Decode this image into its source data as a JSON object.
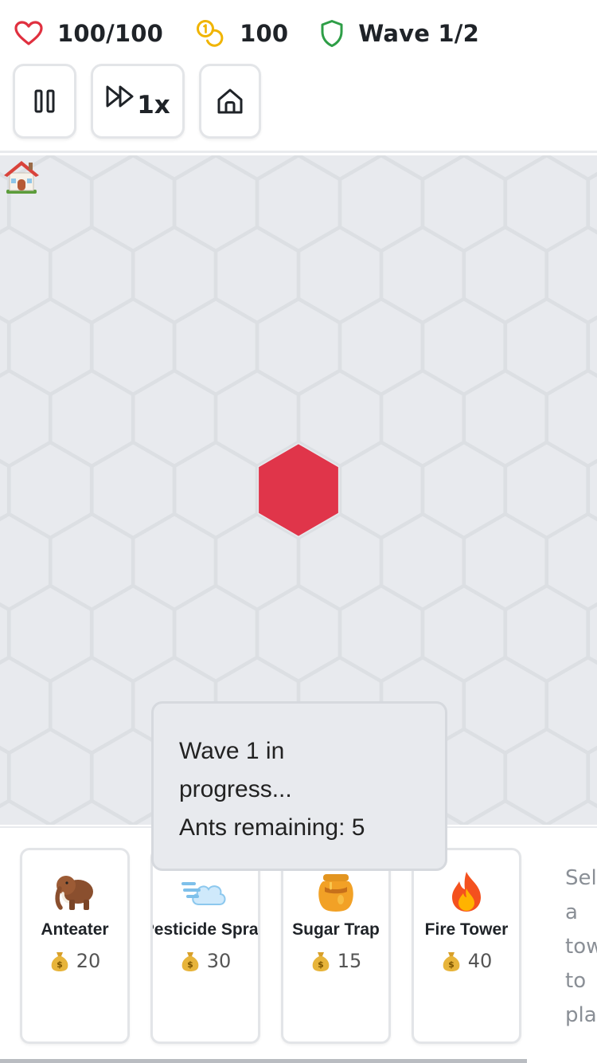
{
  "hud": {
    "lives": "100/100",
    "gold": "100",
    "wave": "Wave 1/2",
    "speed_label": "1x",
    "icons": {
      "lives": "heart-icon",
      "gold": "coins-icon",
      "wave": "shield-icon",
      "pause": "pause-icon",
      "speed": "fast-forward-icon",
      "home": "home-icon"
    },
    "colors": {
      "lives": "#e0303f",
      "gold": "#f0b400",
      "wave": "#2e9e47"
    }
  },
  "board": {
    "base_icon": "house-icon",
    "base_color": "#e0354a",
    "tile_color": "#e8eaee",
    "tile_stroke": "#dcdfe3"
  },
  "status": {
    "line1": "Wave 1 in",
    "line2": "progress...",
    "line3": "Ants remaining: 5"
  },
  "shop": {
    "towers": [
      {
        "name": "Anteater",
        "cost": "20",
        "icon": "mammoth-icon"
      },
      {
        "name": "Pesticide Spray",
        "cost": "30",
        "icon": "dash-cloud-icon"
      },
      {
        "name": "Sugar Trap",
        "cost": "15",
        "icon": "honey-pot-icon"
      },
      {
        "name": "Fire Tower",
        "cost": "40",
        "icon": "fire-icon"
      }
    ],
    "hint_lines": [
      "Sel",
      "a",
      "tow",
      "to",
      "pla"
    ]
  }
}
